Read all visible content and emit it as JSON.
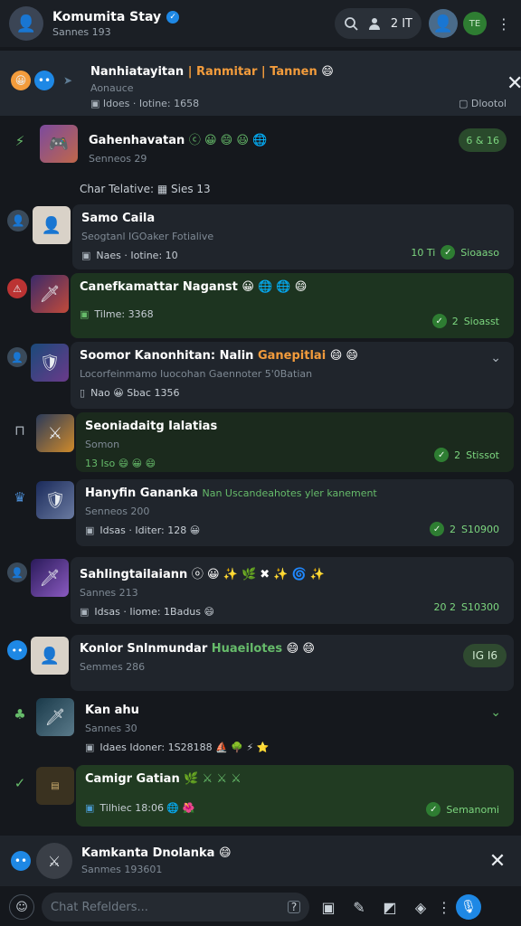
{
  "header": {
    "title": "Komumita Stay",
    "subtitle": "Sannes 193",
    "count": "2 IT",
    "right_badge": "TE"
  },
  "banner": {
    "title_main": "Nanhiatayitan ",
    "title_highlight": "| Ranmitar | Tannen",
    "sub": "Aonauce",
    "meta_left": "Idoes · Iotine: 1658",
    "meta_right": "Dlootol"
  },
  "chats": [
    {
      "name": "Gahenhavatan",
      "emoji": "ⓒ 😀 😄 😃 🌐",
      "sub": "Senneos 29",
      "badge": "6 & 16"
    },
    {
      "section": "Char Telative:",
      "section_tail": "Sies 13"
    },
    {
      "name": "Samo Caila",
      "sub": "Seogtanl IGOaker Fotialive",
      "meta": "Naes · Iotine: 10",
      "badge_num": "10 Ti",
      "badge_txt": "Sioaaso"
    },
    {
      "name": "Canefkamattar Naganst",
      "emoji": "😀 🌐 🌐 😄",
      "meta": "Tilme: 3368",
      "badge_num": "2",
      "badge_txt": "Sioasst"
    },
    {
      "name": "Soomor Kanonhitan: Nalin",
      "name_hl": "Ganepitlai",
      "emoji": "😄 😄",
      "sub": "Locorfeinmamo Iuocohan Gaennoter 5'0Batian",
      "meta": "Nao 😀 Sbac 1356"
    },
    {
      "name": "Seoniadaitg Ialatias",
      "sub": "Somon",
      "meta": "13 Iso 😄 😀 😄",
      "badge_num": "2",
      "badge_txt": "Stissot"
    },
    {
      "name": "Hanyfin Gananka",
      "name_hl": "Nan Uscandeahotes yler kanement",
      "sub": "Senneos 200",
      "meta": "Idsas · Iditer: 128 😀",
      "badge_num": "2",
      "badge_txt": "S10900"
    },
    {
      "name": "Sahlingtailaiann",
      "emoji": "ⓞ 😀 ✨ 🌿 ✖ ✨ 🌀 ✨",
      "sub": "Sannes 213",
      "meta": "Idsas · Iiome: 1Badus 😄",
      "badge_num": "20 2",
      "badge_txt": "S10300"
    },
    {
      "name": "Konlor Snlnmundar",
      "name_hl": "Huaeilotes",
      "emoji": "😄 😄",
      "sub": "Semmes 286",
      "chip": "IG I6"
    },
    {
      "name": "Kan ahu",
      "sub": "Sannes 30",
      "meta": "Idaes  Idoner: 1S28188  ⛵  🌳  ⚡  ⭐"
    },
    {
      "name": "Camigr Gatian",
      "emoji": "🌿 ⚔ ⚔ ⚔",
      "meta": "Tilhiec 18:06 🌐 🌺",
      "badge_txt": "Semanomi"
    }
  ],
  "bottom_pin": {
    "title": "Kamkanta Dnolanka",
    "sub": "Sanmes 193601"
  },
  "input": {
    "placeholder": "Chat Refelders..."
  }
}
